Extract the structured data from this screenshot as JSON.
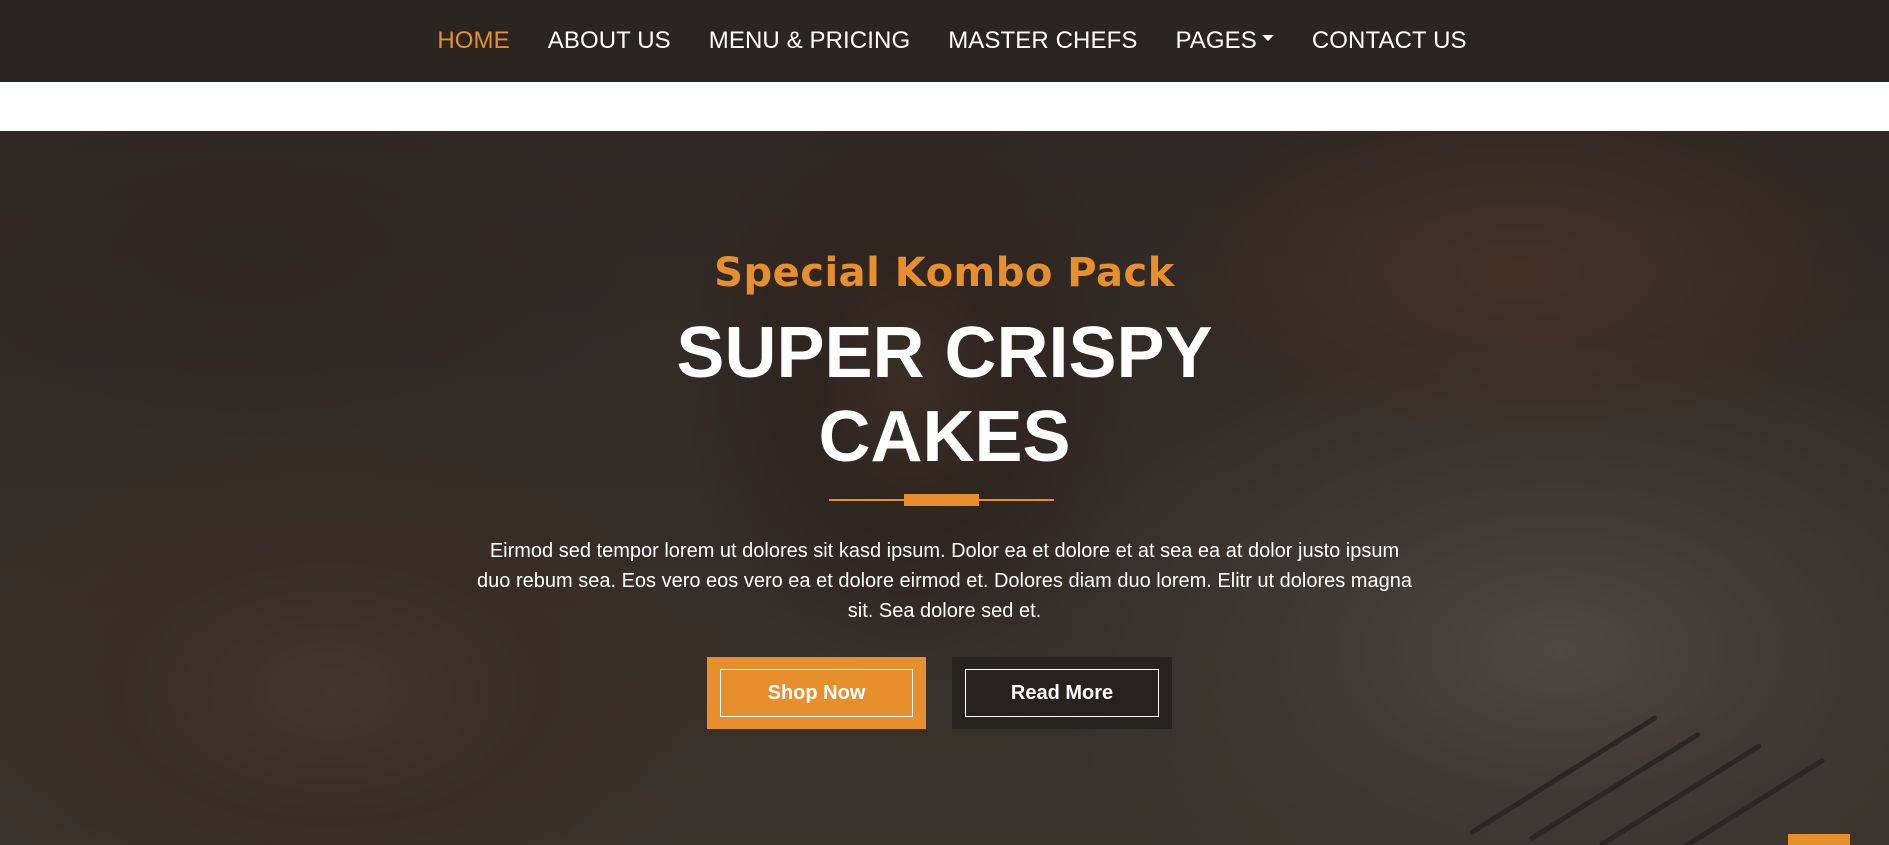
{
  "nav": {
    "items": [
      {
        "label": "HOME",
        "active": true
      },
      {
        "label": "ABOUT US",
        "active": false
      },
      {
        "label": "MENU & PRICING",
        "active": false
      },
      {
        "label": "MASTER CHEFS",
        "active": false
      },
      {
        "label": "PAGES",
        "active": false,
        "dropdown": true
      },
      {
        "label": "CONTACT US",
        "active": false
      }
    ]
  },
  "hero": {
    "subtitle": "Special Kombo Pack",
    "title_line1": "SUPER CRISPY",
    "title_line2": "CAKES",
    "description": "Eirmod sed tempor lorem ut dolores sit kasd ipsum. Dolor ea et dolore et at sea ea at dolor justo ipsum duo rebum sea. Eos vero eos vero ea et dolore eirmod et. Dolores diam duo lorem. Elitr ut dolores magna sit. Sea dolore sed et.",
    "primary_button": "Shop Now",
    "secondary_button": "Read More"
  },
  "colors": {
    "accent": "#e78f2c",
    "navbar_bg": "#2a2520",
    "text_light": "#ffffff"
  },
  "icons": {
    "dropdown": "caret-down-icon"
  }
}
